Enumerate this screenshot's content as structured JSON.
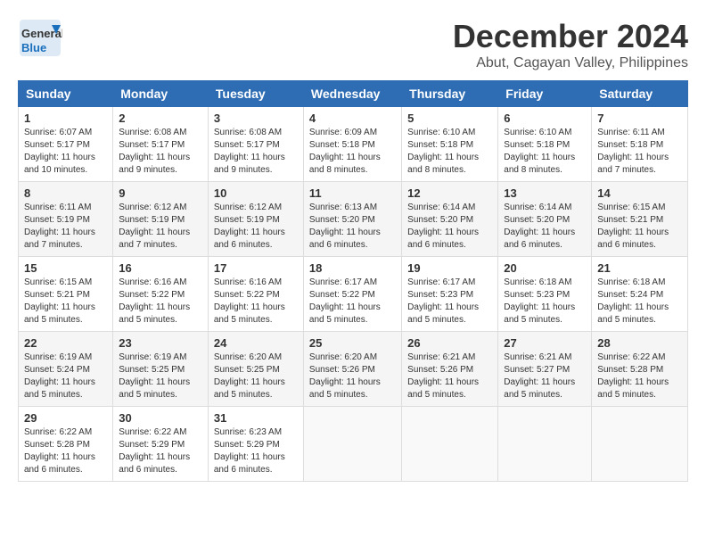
{
  "header": {
    "logo_general": "General",
    "logo_blue": "Blue",
    "month_title": "December 2024",
    "location": "Abut, Cagayan Valley, Philippines"
  },
  "calendar": {
    "columns": [
      "Sunday",
      "Monday",
      "Tuesday",
      "Wednesday",
      "Thursday",
      "Friday",
      "Saturday"
    ],
    "weeks": [
      [
        {
          "day": "1",
          "sunrise": "Sunrise: 6:07 AM",
          "sunset": "Sunset: 5:17 PM",
          "daylight": "Daylight: 11 hours and 10 minutes."
        },
        {
          "day": "2",
          "sunrise": "Sunrise: 6:08 AM",
          "sunset": "Sunset: 5:17 PM",
          "daylight": "Daylight: 11 hours and 9 minutes."
        },
        {
          "day": "3",
          "sunrise": "Sunrise: 6:08 AM",
          "sunset": "Sunset: 5:17 PM",
          "daylight": "Daylight: 11 hours and 9 minutes."
        },
        {
          "day": "4",
          "sunrise": "Sunrise: 6:09 AM",
          "sunset": "Sunset: 5:18 PM",
          "daylight": "Daylight: 11 hours and 8 minutes."
        },
        {
          "day": "5",
          "sunrise": "Sunrise: 6:10 AM",
          "sunset": "Sunset: 5:18 PM",
          "daylight": "Daylight: 11 hours and 8 minutes."
        },
        {
          "day": "6",
          "sunrise": "Sunrise: 6:10 AM",
          "sunset": "Sunset: 5:18 PM",
          "daylight": "Daylight: 11 hours and 8 minutes."
        },
        {
          "day": "7",
          "sunrise": "Sunrise: 6:11 AM",
          "sunset": "Sunset: 5:18 PM",
          "daylight": "Daylight: 11 hours and 7 minutes."
        }
      ],
      [
        {
          "day": "8",
          "sunrise": "Sunrise: 6:11 AM",
          "sunset": "Sunset: 5:19 PM",
          "daylight": "Daylight: 11 hours and 7 minutes."
        },
        {
          "day": "9",
          "sunrise": "Sunrise: 6:12 AM",
          "sunset": "Sunset: 5:19 PM",
          "daylight": "Daylight: 11 hours and 7 minutes."
        },
        {
          "day": "10",
          "sunrise": "Sunrise: 6:12 AM",
          "sunset": "Sunset: 5:19 PM",
          "daylight": "Daylight: 11 hours and 6 minutes."
        },
        {
          "day": "11",
          "sunrise": "Sunrise: 6:13 AM",
          "sunset": "Sunset: 5:20 PM",
          "daylight": "Daylight: 11 hours and 6 minutes."
        },
        {
          "day": "12",
          "sunrise": "Sunrise: 6:14 AM",
          "sunset": "Sunset: 5:20 PM",
          "daylight": "Daylight: 11 hours and 6 minutes."
        },
        {
          "day": "13",
          "sunrise": "Sunrise: 6:14 AM",
          "sunset": "Sunset: 5:20 PM",
          "daylight": "Daylight: 11 hours and 6 minutes."
        },
        {
          "day": "14",
          "sunrise": "Sunrise: 6:15 AM",
          "sunset": "Sunset: 5:21 PM",
          "daylight": "Daylight: 11 hours and 6 minutes."
        }
      ],
      [
        {
          "day": "15",
          "sunrise": "Sunrise: 6:15 AM",
          "sunset": "Sunset: 5:21 PM",
          "daylight": "Daylight: 11 hours and 5 minutes."
        },
        {
          "day": "16",
          "sunrise": "Sunrise: 6:16 AM",
          "sunset": "Sunset: 5:22 PM",
          "daylight": "Daylight: 11 hours and 5 minutes."
        },
        {
          "day": "17",
          "sunrise": "Sunrise: 6:16 AM",
          "sunset": "Sunset: 5:22 PM",
          "daylight": "Daylight: 11 hours and 5 minutes."
        },
        {
          "day": "18",
          "sunrise": "Sunrise: 6:17 AM",
          "sunset": "Sunset: 5:22 PM",
          "daylight": "Daylight: 11 hours and 5 minutes."
        },
        {
          "day": "19",
          "sunrise": "Sunrise: 6:17 AM",
          "sunset": "Sunset: 5:23 PM",
          "daylight": "Daylight: 11 hours and 5 minutes."
        },
        {
          "day": "20",
          "sunrise": "Sunrise: 6:18 AM",
          "sunset": "Sunset: 5:23 PM",
          "daylight": "Daylight: 11 hours and 5 minutes."
        },
        {
          "day": "21",
          "sunrise": "Sunrise: 6:18 AM",
          "sunset": "Sunset: 5:24 PM",
          "daylight": "Daylight: 11 hours and 5 minutes."
        }
      ],
      [
        {
          "day": "22",
          "sunrise": "Sunrise: 6:19 AM",
          "sunset": "Sunset: 5:24 PM",
          "daylight": "Daylight: 11 hours and 5 minutes."
        },
        {
          "day": "23",
          "sunrise": "Sunrise: 6:19 AM",
          "sunset": "Sunset: 5:25 PM",
          "daylight": "Daylight: 11 hours and 5 minutes."
        },
        {
          "day": "24",
          "sunrise": "Sunrise: 6:20 AM",
          "sunset": "Sunset: 5:25 PM",
          "daylight": "Daylight: 11 hours and 5 minutes."
        },
        {
          "day": "25",
          "sunrise": "Sunrise: 6:20 AM",
          "sunset": "Sunset: 5:26 PM",
          "daylight": "Daylight: 11 hours and 5 minutes."
        },
        {
          "day": "26",
          "sunrise": "Sunrise: 6:21 AM",
          "sunset": "Sunset: 5:26 PM",
          "daylight": "Daylight: 11 hours and 5 minutes."
        },
        {
          "day": "27",
          "sunrise": "Sunrise: 6:21 AM",
          "sunset": "Sunset: 5:27 PM",
          "daylight": "Daylight: 11 hours and 5 minutes."
        },
        {
          "day": "28",
          "sunrise": "Sunrise: 6:22 AM",
          "sunset": "Sunset: 5:28 PM",
          "daylight": "Daylight: 11 hours and 5 minutes."
        }
      ],
      [
        {
          "day": "29",
          "sunrise": "Sunrise: 6:22 AM",
          "sunset": "Sunset: 5:28 PM",
          "daylight": "Daylight: 11 hours and 6 minutes."
        },
        {
          "day": "30",
          "sunrise": "Sunrise: 6:22 AM",
          "sunset": "Sunset: 5:29 PM",
          "daylight": "Daylight: 11 hours and 6 minutes."
        },
        {
          "day": "31",
          "sunrise": "Sunrise: 6:23 AM",
          "sunset": "Sunset: 5:29 PM",
          "daylight": "Daylight: 11 hours and 6 minutes."
        },
        null,
        null,
        null,
        null
      ]
    ]
  }
}
